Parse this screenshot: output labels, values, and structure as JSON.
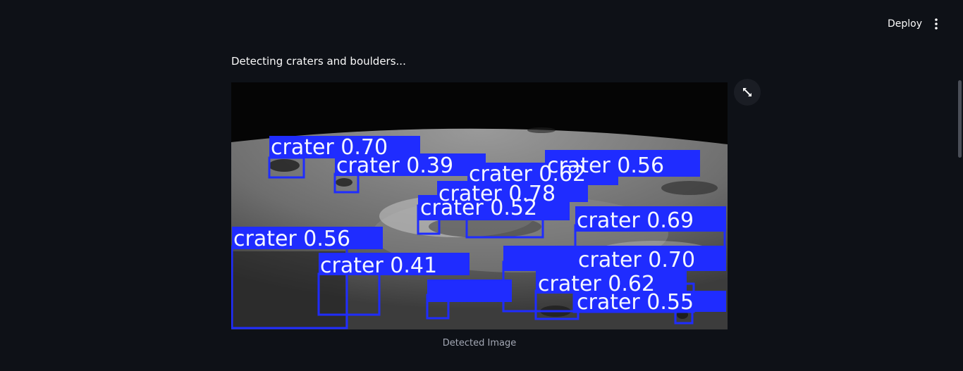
{
  "toolbar": {
    "deploy_label": "Deploy",
    "menu_icon": "more-vertical-icon"
  },
  "main": {
    "status_text": "Detecting craters and boulders...",
    "caption": "Detected Image",
    "fullscreen_icon": "fullscreen-icon"
  },
  "detections": {
    "box_color": "#1f2cff",
    "labels": [
      "crater 0.70",
      "crater 0.39",
      "crater 0.62",
      "crater 0.56",
      "crater 0.78",
      "crater 0.52",
      "crater 0.69",
      "crater 0.56",
      "crater 0.41",
      "crater 0.70",
      "crater 0.62",
      "crater 0.55"
    ]
  }
}
